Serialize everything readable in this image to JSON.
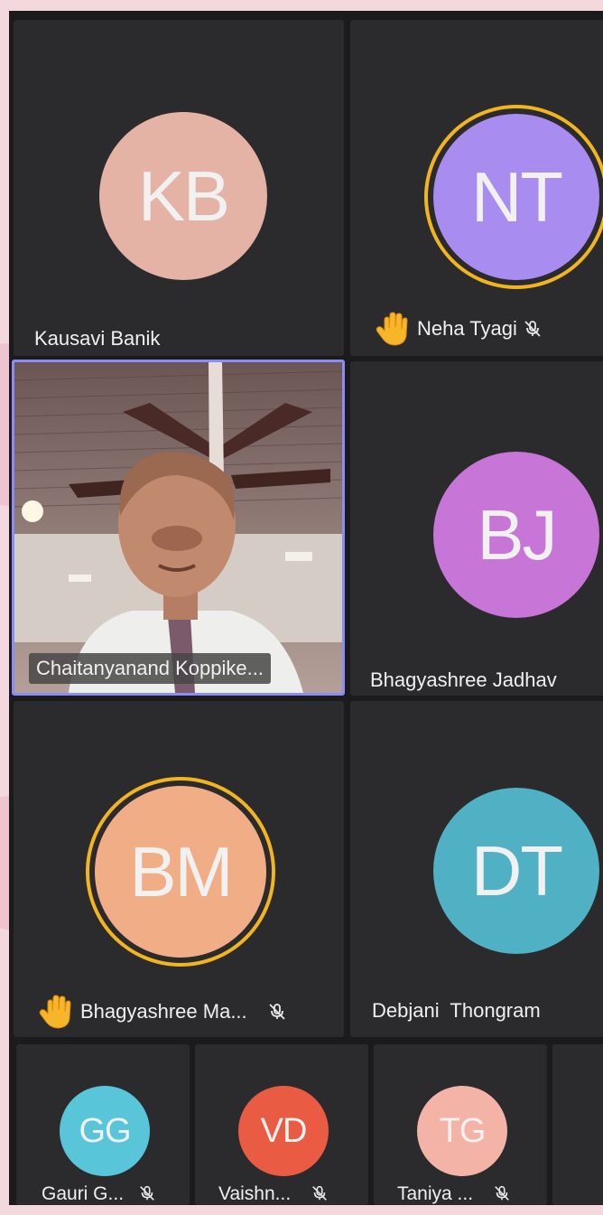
{
  "participants": [
    {
      "initials": "KB",
      "name": "Kausavi Banik",
      "avatar_color": "#e4b3a6"
    },
    {
      "initials": "NT",
      "name": "Neha Tyagi",
      "avatar_color": "#a98cf0",
      "hand_raised": true,
      "muted": true
    },
    {
      "name": "Chaitanyanand Koppike...",
      "video": true,
      "active_speaker": true
    },
    {
      "initials": "BJ",
      "name": "Bhagyashree Jadhav",
      "avatar_color": "#c775d6"
    },
    {
      "initials": "BM",
      "name": "Bhagyashree Ma...",
      "avatar_color": "#f0ad86",
      "hand_raised": true,
      "muted": true
    },
    {
      "initials": "DT",
      "name": "Debjani  Thongram",
      "avatar_color": "#4fb1c3"
    },
    {
      "initials": "GG",
      "name": "Gauri G...",
      "avatar_color": "#58c5d8",
      "muted": true
    },
    {
      "initials": "VD",
      "name": "Vaishn...",
      "avatar_color": "#ea5b44",
      "muted": true
    },
    {
      "initials": "TG",
      "name": "Taniya ...",
      "avatar_color": "#f3b3a7",
      "muted": true
    }
  ],
  "colors": {
    "ring": "#f2b51f",
    "active_border": "#8a8df6",
    "tile": "#2b2b2d"
  },
  "icons": {
    "raised_hand": "raised-hand-icon",
    "mute": "mic-muted-icon"
  }
}
